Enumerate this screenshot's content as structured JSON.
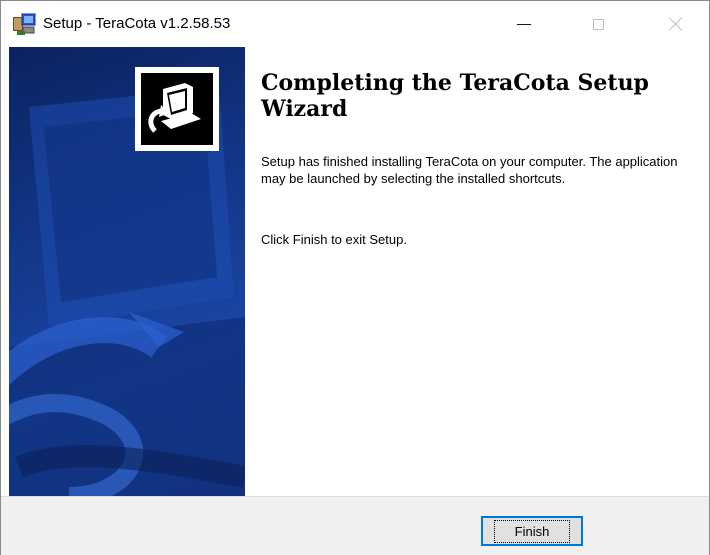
{
  "window": {
    "title": "Setup - TeraCota v1.2.58.53",
    "icon": "installer-setup-icon",
    "controls": {
      "minimize": "minimize-icon",
      "maximize": "maximize-icon",
      "close": "close-icon"
    }
  },
  "sidebar": {
    "logo_icon": "computer-install-icon"
  },
  "main": {
    "heading": "Completing the TeraCota Setup Wizard",
    "paragraph1": "Setup has finished installing TeraCota on your computer. The application may be launched by selecting the installed shortcuts.",
    "paragraph2": "Click Finish to exit Setup."
  },
  "footer": {
    "finish_label": "Finish"
  },
  "colors": {
    "sidebar": "#123585",
    "focus_border": "#0078d7",
    "footer": "#f0f0f0"
  }
}
